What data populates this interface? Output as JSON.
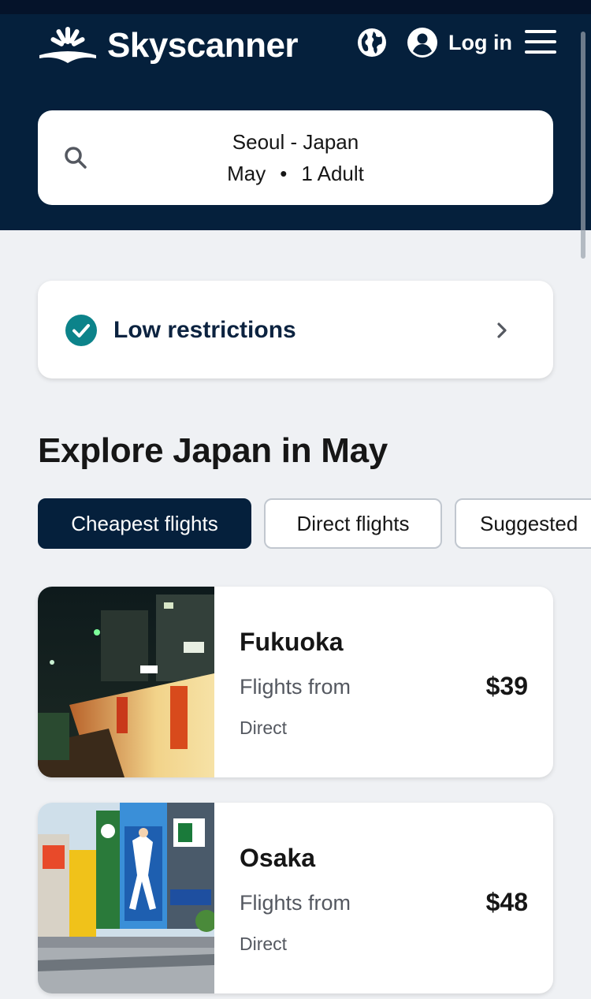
{
  "header": {
    "brand": "Skyscanner",
    "login_label": "Log in",
    "icons": [
      "sun-logo-icon",
      "globe-icon",
      "account-icon",
      "menu-icon"
    ],
    "colors": {
      "navy": "#05203c",
      "accent_teal": "#0c838a"
    }
  },
  "search": {
    "route": "Seoul - Japan",
    "month": "May",
    "separator": "•",
    "travellers": "1 Adult"
  },
  "restrictions": {
    "label": "Low restrictions"
  },
  "explore": {
    "title": "Explore Japan in May",
    "tabs": [
      {
        "label": "Cheapest flights",
        "active": true
      },
      {
        "label": "Direct flights",
        "active": false
      },
      {
        "label": "Suggested",
        "active": false
      }
    ]
  },
  "results": [
    {
      "city": "Fukuoka",
      "from_label": "Flights from",
      "price": "$39",
      "stops": "Direct"
    },
    {
      "city": "Osaka",
      "from_label": "Flights from",
      "price": "$48",
      "stops": "Direct"
    }
  ]
}
